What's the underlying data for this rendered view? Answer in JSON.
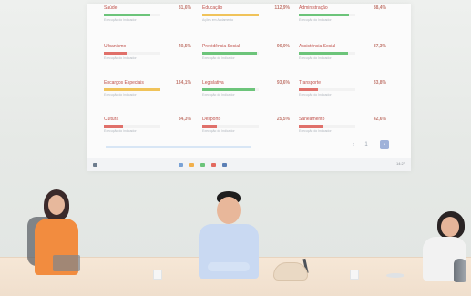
{
  "projection": {
    "kpis": [
      {
        "label": "Saúde",
        "value": "81,6%",
        "sub": "Execução do Indicador",
        "fill": 0.82,
        "color": "#6cc47a"
      },
      {
        "label": "Educação",
        "value": "112,9%",
        "sub": "Ações em Andamento",
        "fill": 1.0,
        "color": "#f0c35a"
      },
      {
        "label": "Administração",
        "value": "88,4%",
        "sub": "Execução do Indicador",
        "fill": 0.88,
        "color": "#6cc47a"
      },
      {
        "label": "Urbanismo",
        "value": "40,5%",
        "sub": "Execução do Indicador",
        "fill": 0.41,
        "color": "#e0706a"
      },
      {
        "label": "Previdência Social",
        "value": "96,0%",
        "sub": "Execução do Indicador",
        "fill": 0.96,
        "color": "#6cc47a"
      },
      {
        "label": "Assistência Social",
        "value": "87,3%",
        "sub": "Execução do Indicador",
        "fill": 0.87,
        "color": "#6cc47a"
      },
      {
        "label": "Encargos Especiais",
        "value": "134,1%",
        "sub": "Execução do Indicador",
        "fill": 1.0,
        "color": "#f0c35a"
      },
      {
        "label": "Legislativa",
        "value": "93,6%",
        "sub": "Execução do Indicador",
        "fill": 0.94,
        "color": "#6cc47a"
      },
      {
        "label": "Transporte",
        "value": "33,8%",
        "sub": "Execução do Indicador",
        "fill": 0.34,
        "color": "#e0706a"
      },
      {
        "label": "Cultura",
        "value": "34,3%",
        "sub": "Execução do Indicador",
        "fill": 0.34,
        "color": "#e0706a"
      },
      {
        "label": "Desporto",
        "value": "25,5%",
        "sub": "Execução do Indicador",
        "fill": 0.26,
        "color": "#e0706a"
      },
      {
        "label": "Saneamento",
        "value": "42,6%",
        "sub": "Execução do Indicador",
        "fill": 0.43,
        "color": "#e0706a"
      }
    ],
    "pager": {
      "prev": "‹",
      "current": "1",
      "next": "›"
    },
    "taskbar": {
      "time": "14:27"
    }
  },
  "scene": {
    "wall_color": "#e9ecea",
    "table_color": "#f0dfcd",
    "person_left_shirt": "#f28c3f",
    "person_center_shirt": "#c9d9f2",
    "person_right_shirt": "#f2f2f2"
  }
}
